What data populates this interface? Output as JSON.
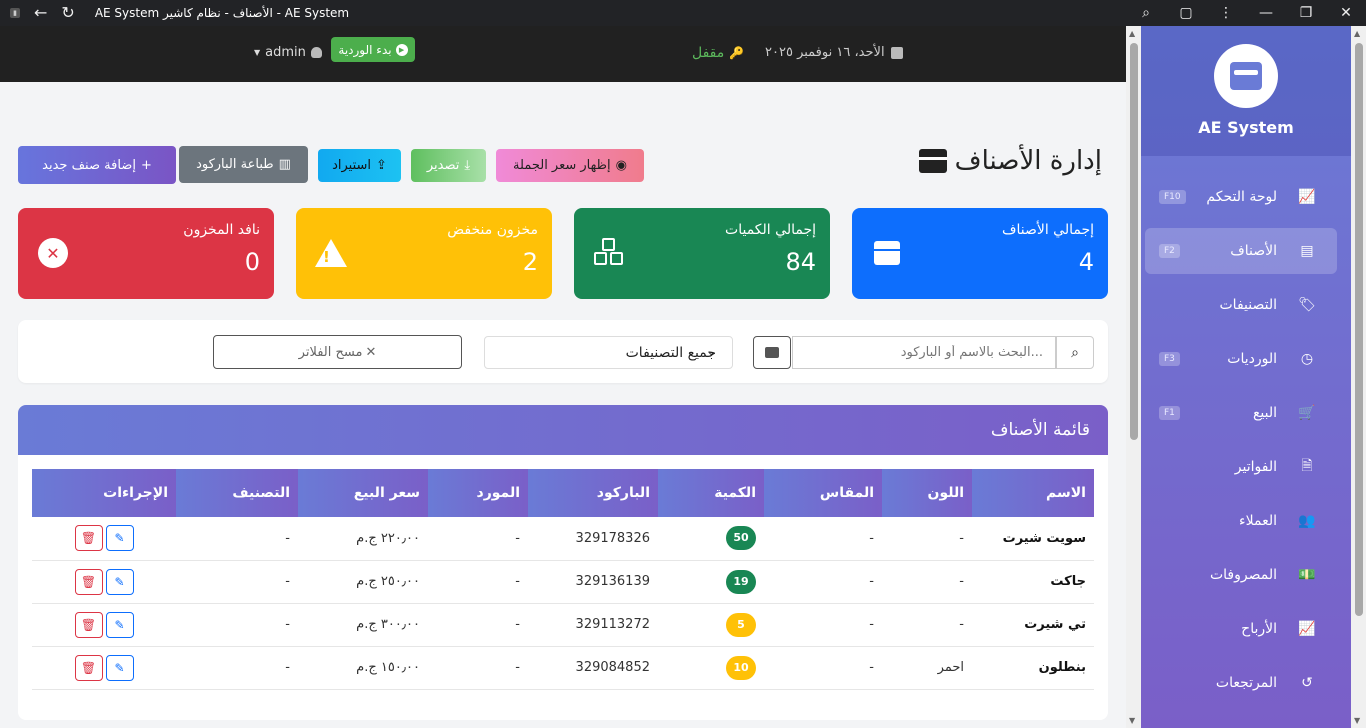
{
  "window": {
    "title": "AE System الأصناف - نظام كاشير - AE System"
  },
  "header": {
    "date": "الأحد، ١٦ نوفمبر ٢٠٢٥",
    "status": "مقفل",
    "shift_button": "بدء الوردية",
    "user": "admin"
  },
  "sidebar": {
    "title": "AE System",
    "items": [
      {
        "label": "لوحة التحكم",
        "key": "F10",
        "icon": "chart-line-icon"
      },
      {
        "label": "الأصناف",
        "key": "F2",
        "icon": "box-icon",
        "active": true
      },
      {
        "label": "التصنيفات",
        "key": "",
        "icon": "tags-icon"
      },
      {
        "label": "الورديات",
        "key": "F3",
        "icon": "clock-icon"
      },
      {
        "label": "البيع",
        "key": "F1",
        "icon": "cart-icon"
      },
      {
        "label": "الفواتير",
        "key": "",
        "icon": "invoice-icon"
      },
      {
        "label": "العملاء",
        "key": "",
        "icon": "users-icon"
      },
      {
        "label": "المصروفات",
        "key": "",
        "icon": "money-icon"
      },
      {
        "label": "الأرباح",
        "key": "",
        "icon": "chart-line-icon"
      },
      {
        "label": "المرتجعات",
        "key": "",
        "icon": "undo-icon"
      }
    ]
  },
  "page": {
    "title": "إدارة الأصناف",
    "buttons": {
      "wholesale": "إظهار سعر الجملة",
      "export": "تصدير",
      "import": "استيراد",
      "barcode": "طباعة الباركود",
      "add": "إضافة صنف جديد"
    }
  },
  "stats": {
    "total_items": {
      "label": "إجمالي الأصناف",
      "value": "4"
    },
    "total_qty": {
      "label": "إجمالي الكميات",
      "value": "84"
    },
    "low_stock": {
      "label": "مخزون منخفض",
      "value": "2"
    },
    "out_stock": {
      "label": "نافد المخزون",
      "value": "0"
    }
  },
  "filters": {
    "search_placeholder": "البحث بالاسم أو الباركود...",
    "category": "جميع التصنيفات",
    "clear": "مسح الفلاتر"
  },
  "list": {
    "title": "قائمة الأصناف",
    "columns": [
      "الاسم",
      "اللون",
      "المقاس",
      "الكمية",
      "الباركود",
      "المورد",
      "سعر البيع",
      "التصنيف",
      "الإجراءات"
    ],
    "rows": [
      {
        "name": "سويت شيرت",
        "color": "-",
        "size": "-",
        "qty": "50",
        "barcode": "329178326",
        "supplier": "-",
        "price": "٢٢٠٫٠٠ ج.م",
        "category": "-"
      },
      {
        "name": "جاكت",
        "color": "-",
        "size": "-",
        "qty": "19",
        "barcode": "329136139",
        "supplier": "-",
        "price": "٢٥٠٫٠٠ ج.م",
        "category": "-"
      },
      {
        "name": "تي شيرت",
        "color": "-",
        "size": "-",
        "qty": "5",
        "barcode": "329113272",
        "supplier": "-",
        "price": "٣٠٠٫٠٠ ج.م",
        "category": "-"
      },
      {
        "name": "بنطلون",
        "color": "احمر",
        "size": "-",
        "qty": "10",
        "barcode": "329084852",
        "supplier": "-",
        "price": "١٥٠٫٠٠ ج.م",
        "category": "-"
      }
    ]
  }
}
